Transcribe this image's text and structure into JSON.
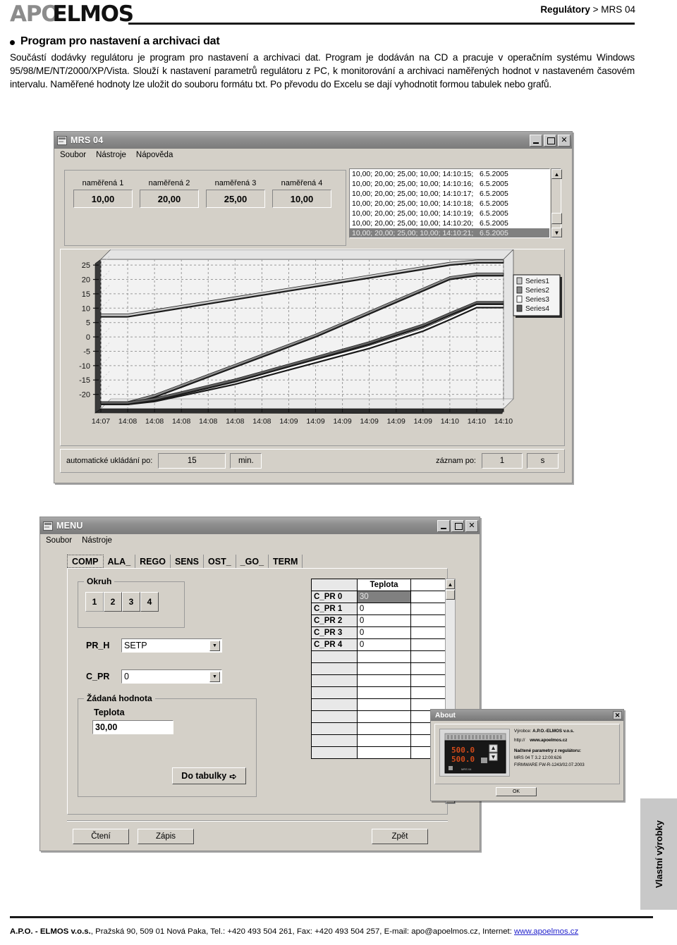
{
  "header": {
    "logo_gray": "APO",
    "logo_black": "ELMOS",
    "breadcrumb_bold": "Regulátory",
    "breadcrumb_rest": "> MRS 04"
  },
  "intro": {
    "title": "Program pro nastavení a archivaci dat",
    "paragraph": "Součástí dodávky regulátoru je program pro nastavení a archivaci dat. Program je dodáván na CD a pracuje v operačním systému Windows 95/98/ME/NT/2000/XP/Vista. Slouží k nastavení parametrů regulátoru z PC, k monitorování a archivaci naměřených hodnot v nastaveném časovém intervalu. Naměřené hodnoty lze uložit do souboru formátu txt. Po převodu do Excelu se dají vyhodnotit formou tabulek nebo grafů."
  },
  "mrs_window": {
    "title": "MRS 04",
    "menu": [
      "Soubor",
      "Nástroje",
      "Nápověda"
    ],
    "window_buttons": {
      "minimize": "_",
      "maximize": "□",
      "close": "✕"
    },
    "measured": [
      {
        "label": "naměřená 1",
        "value": "10,00"
      },
      {
        "label": "naměřená 2",
        "value": "20,00"
      },
      {
        "label": "naměřená 3",
        "value": "25,00"
      },
      {
        "label": "naměřená 4",
        "value": "10,00"
      }
    ],
    "log_rows": [
      {
        "text": "10,00; 20,00; 25,00; 10,00; 14:10:15;   6.5.2005",
        "selected": false
      },
      {
        "text": "10,00; 20,00; 25,00; 10,00; 14:10:16;   6.5.2005",
        "selected": false
      },
      {
        "text": "10,00; 20,00; 25,00; 10,00; 14:10:17;   6.5.2005",
        "selected": false
      },
      {
        "text": "10,00; 20,00; 25,00; 10,00; 14:10:18;   6.5.2005",
        "selected": false
      },
      {
        "text": "10,00; 20,00; 25,00; 10,00; 14:10:19;   6.5.2005",
        "selected": false
      },
      {
        "text": "10,00; 20,00; 25,00; 10,00; 14:10:20;   6.5.2005",
        "selected": false
      },
      {
        "text": "10,00; 20,00; 25,00; 10,00; 14:10:21;   6.5.2005",
        "selected": true
      }
    ],
    "scroll_up_glyph": "▲",
    "scroll_down_glyph": "▼",
    "status": {
      "autosave_label": "automatické ukládání po:",
      "autosave_value": "15",
      "autosave_unit": "min.",
      "record_label": "záznam po:",
      "record_value": "1",
      "record_unit": "s"
    }
  },
  "chart_data": {
    "type": "line",
    "title": "",
    "xlabel": "",
    "ylabel": "",
    "ylim": [
      -25,
      27
    ],
    "yticks": [
      25,
      20,
      15,
      10,
      5,
      0,
      -5,
      -10,
      -15,
      -20
    ],
    "grid": true,
    "legend_position": "right",
    "x": [
      "14:07",
      "14:08",
      "14:08",
      "14:08",
      "14:08",
      "14:08",
      "14:08",
      "14:09",
      "14:09",
      "14:09",
      "14:09",
      "14:09",
      "14:09",
      "14:10",
      "14:10",
      "14:10"
    ],
    "series": [
      {
        "name": "Series1",
        "values": [
          7.0,
          7.0,
          8.5,
          10.0,
          11.5,
          13.0,
          14.5,
          16.0,
          17.5,
          19.0,
          20.5,
          22.0,
          23.5,
          25.0,
          25.8,
          25.8
        ]
      },
      {
        "name": "Series2",
        "values": [
          -23.5,
          -23.5,
          -21.0,
          -17.5,
          -14.0,
          -10.5,
          -7.0,
          -3.5,
          0.0,
          4.0,
          8.0,
          12.0,
          16.0,
          20.0,
          21.3,
          21.3
        ]
      },
      {
        "name": "Series3",
        "values": [
          -23.5,
          -23.5,
          -22.5,
          -20.5,
          -18.5,
          -16.5,
          -14.0,
          -11.5,
          -9.0,
          -6.5,
          -4.0,
          -1.0,
          2.0,
          6.0,
          10.2,
          10.2
        ]
      },
      {
        "name": "Series4",
        "values": [
          -23.5,
          -23.5,
          -22.2,
          -20.0,
          -17.8,
          -15.6,
          -13.0,
          -10.4,
          -7.8,
          -5.2,
          -2.6,
          0.5,
          3.5,
          7.5,
          11.4,
          11.4
        ]
      }
    ],
    "legend": [
      "Series1",
      "Series2",
      "Series3",
      "Series4"
    ]
  },
  "menu_window": {
    "title": "MENU",
    "menu": [
      "Soubor",
      "Nástroje"
    ],
    "window_buttons": {
      "minimize": "_",
      "maximize": "□",
      "close": "✕"
    },
    "tabs": [
      {
        "label": "COMP",
        "active": true
      },
      {
        "label": "ALA_",
        "active": false
      },
      {
        "label": "REGO",
        "active": false
      },
      {
        "label": "SENS",
        "active": false
      },
      {
        "label": "OST_",
        "active": false
      },
      {
        "label": "_GO_",
        "active": false
      },
      {
        "label": "TERM",
        "active": false
      }
    ],
    "okruh": {
      "title": "Okruh",
      "buttons": [
        "1",
        "2",
        "3",
        "4"
      ],
      "selected": "1"
    },
    "pr_h": {
      "label": "PR_H",
      "value": "SETP"
    },
    "c_pr": {
      "label": "C_PR",
      "value": "0"
    },
    "zadana": {
      "title": "Žádaná hodnota",
      "field_label": "Teplota",
      "field_value": "30,00",
      "button_label": "Do tabulky",
      "button_arrow": "➪"
    },
    "grid": {
      "headers": [
        "",
        "Teplota",
        ""
      ],
      "rows": [
        {
          "name": "C_PR 0",
          "value": "30",
          "selected": true
        },
        {
          "name": "C_PR 1",
          "value": "0",
          "selected": false
        },
        {
          "name": "C_PR 2",
          "value": "0",
          "selected": false
        },
        {
          "name": "C_PR 3",
          "value": "0",
          "selected": false
        },
        {
          "name": "C_PR 4",
          "value": "0",
          "selected": false
        },
        {
          "name": "",
          "value": "",
          "selected": false
        },
        {
          "name": "",
          "value": "",
          "selected": false
        },
        {
          "name": "",
          "value": "",
          "selected": false
        },
        {
          "name": "",
          "value": "",
          "selected": false
        },
        {
          "name": "",
          "value": "",
          "selected": false
        },
        {
          "name": "",
          "value": "",
          "selected": false
        },
        {
          "name": "",
          "value": "",
          "selected": false
        },
        {
          "name": "",
          "value": "",
          "selected": false
        },
        {
          "name": "",
          "value": "",
          "selected": false
        }
      ],
      "scroll_up_glyph": "▲",
      "scroll_down_glyph": "▼"
    },
    "buttons": {
      "read": "Čtení",
      "write": "Zápis",
      "back": "Zpět"
    }
  },
  "about_dialog": {
    "title": "About",
    "close_glyph": "✕",
    "manufacturer_label": "Výrobce:",
    "manufacturer": "A.P.O.-ELMOS v.o.s.",
    "http_label": "http://",
    "url": "www.apoelmos.cz",
    "params_label": "Načtené parametry z regulátoru:",
    "device_line": "MRS 04 T  3.2          12:00:626",
    "firmware_line": "FIRMWARE FW-R-1243/02.07.2003",
    "ok_label": "OK",
    "device_display_top": "500.0",
    "device_display_bottom": "500.0",
    "device_model": "MRS 04"
  },
  "side_tab": {
    "label": "Vlastní výrobky"
  },
  "footer": {
    "company": "A.P.O. - ELMOS v.o.s.",
    "address": ", Pražská 90, 509 01 Nová Paka, Tel.: +420 493 504 261, Fax: +420 493 504 257, E-mail: apo@apoelmos.cz, Internet: ",
    "web": "www.apoelmos.cz"
  }
}
